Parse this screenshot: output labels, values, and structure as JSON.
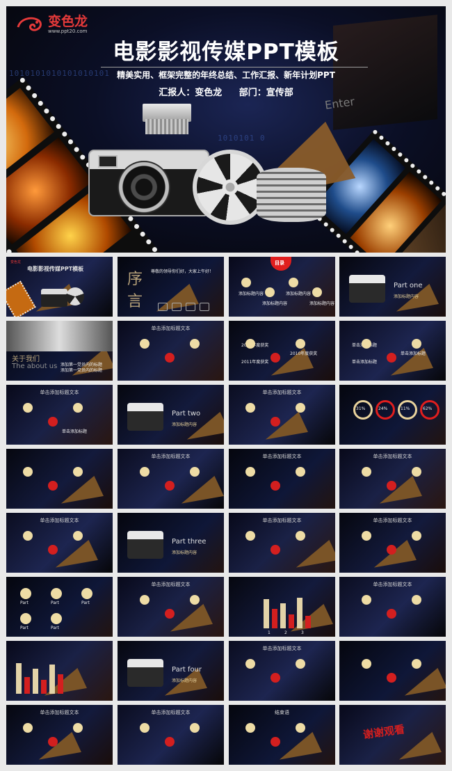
{
  "hero": {
    "brand_name": "变色龙",
    "brand_url": "www.ppt20.com",
    "title": "电影影视传媒PPT模板",
    "subtitle": "精美实用、框架完整的年终总结、工作汇报、新年计划PPT",
    "reporter": "汇报人：变色龙",
    "department": "部门：宣传部",
    "binary_1": "1010101010101010101",
    "binary_2": "1010101 0",
    "enter_key": "Enter"
  },
  "slides": [
    {
      "title": "电影影视传媒PPT模板",
      "brand": "变色龙",
      "tag": ""
    },
    {
      "title": "序",
      "title2": "言",
      "tag": "尊敬的领导你们好，大家上午好！"
    },
    {
      "title": "目录",
      "items": [
        "添加标题内容",
        "添加标题内容",
        "添加标题内容",
        "添加标题内容"
      ]
    },
    {
      "title": "Part one",
      "tag": "添加标题内容"
    },
    {
      "title": "关于我们",
      "tag": "The about us",
      "note1": "添加第一党员内的标题",
      "note2": "添加第一党员内的标题"
    },
    {
      "title": "单击添加标题文本"
    },
    {
      "title": "",
      "items": [
        "2009年度获奖",
        "2010年度获奖",
        "2011年度获奖"
      ]
    },
    {
      "title": "",
      "items": [
        "单击添加标题",
        "单击添加标题",
        "单击添加标题"
      ]
    },
    {
      "title": "单击添加标题文本",
      "label": "单击添加标题"
    },
    {
      "title": "Part two",
      "tag": "添加标题内容"
    },
    {
      "title": "单击添加标题文本"
    },
    {
      "title": "",
      "values": [
        "31%",
        "24%",
        "11%",
        "62%"
      ]
    },
    {
      "title": ""
    },
    {
      "title": "单击添加标题文本"
    },
    {
      "title": "单击添加标题文本"
    },
    {
      "title": "单击添加标题文本"
    },
    {
      "title": "单击添加标题文本"
    },
    {
      "title": "Part three",
      "tag": "添加标题内容"
    },
    {
      "title": "单击添加标题文本"
    },
    {
      "title": "单击添加标题文本"
    },
    {
      "title": "",
      "labels": [
        "Part",
        "Part",
        "Part",
        "Part",
        "Part"
      ]
    },
    {
      "title": "单击添加标题文本"
    },
    {
      "title": "单击添加标题文本",
      "ticks": [
        "1",
        "2",
        "3"
      ]
    },
    {
      "title": "单击添加标题文本"
    },
    {
      "title": ""
    },
    {
      "title": "Part four",
      "tag": "添加标题内容"
    },
    {
      "title": "单击添加标题文本"
    },
    {
      "title": ""
    },
    {
      "title": "单击添加标题文本"
    },
    {
      "title": "单击添加标题文本"
    },
    {
      "title": "结束语"
    },
    {
      "title": "谢谢观看"
    }
  ]
}
